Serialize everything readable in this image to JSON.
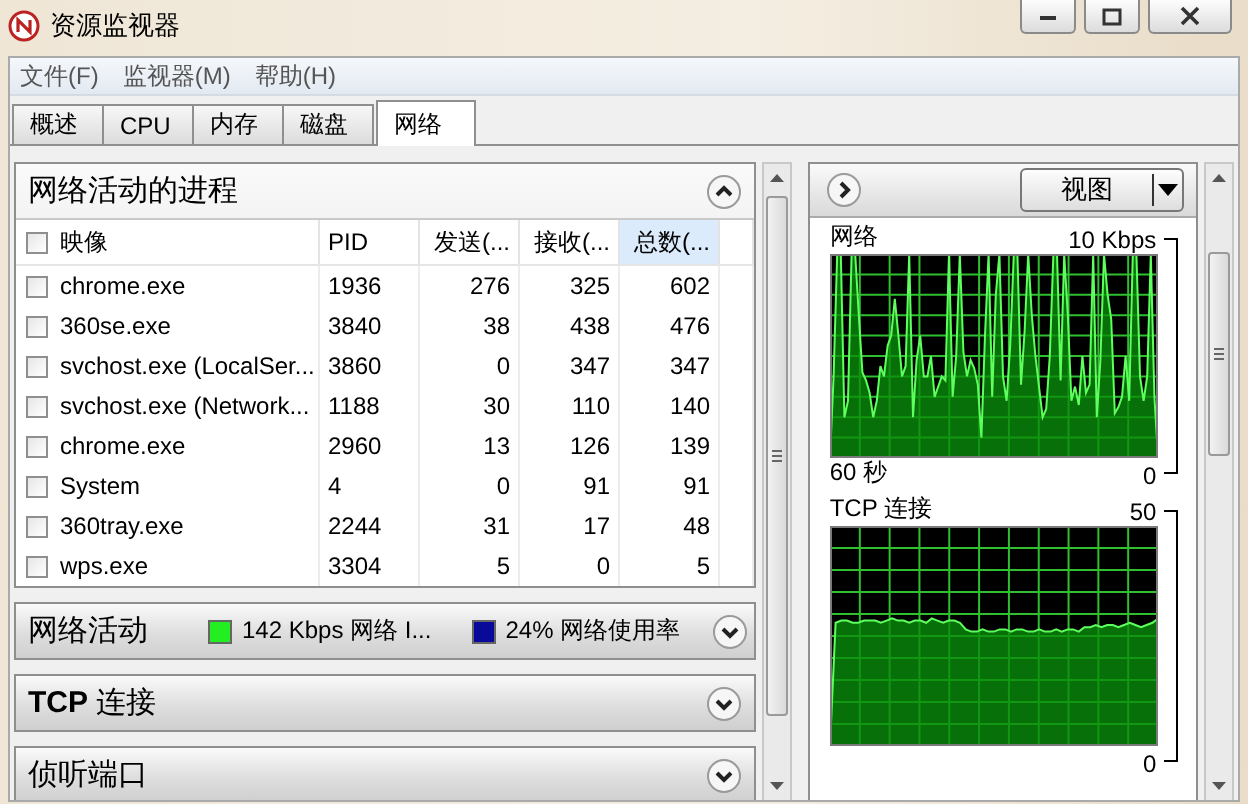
{
  "window": {
    "title": "资源监视器"
  },
  "menu": [
    "文件(F)",
    "监视器(M)",
    "帮助(H)"
  ],
  "tabs": [
    {
      "label": "概述",
      "selected": false
    },
    {
      "label": "CPU",
      "selected": false
    },
    {
      "label": "内存",
      "selected": false
    },
    {
      "label": "磁盘",
      "selected": false
    },
    {
      "label": "网络",
      "selected": true
    }
  ],
  "processes": {
    "title": "网络活动的进程",
    "expanded": true,
    "columns": [
      {
        "label": "映像",
        "sorted": false
      },
      {
        "label": "PID",
        "sorted": false
      },
      {
        "label": "发送(...",
        "sorted": false
      },
      {
        "label": "接收(...",
        "sorted": false
      },
      {
        "label": "总数(...",
        "sorted": true
      }
    ],
    "header_checked": false,
    "rows": [
      {
        "checked": false,
        "cells": [
          "chrome.exe",
          "1936",
          "276",
          "325",
          "602"
        ]
      },
      {
        "checked": false,
        "cells": [
          "360se.exe",
          "3840",
          "38",
          "438",
          "476"
        ]
      },
      {
        "checked": false,
        "cells": [
          "svchost.exe (LocalSer...",
          "3860",
          "0",
          "347",
          "347"
        ]
      },
      {
        "checked": false,
        "cells": [
          "svchost.exe (Network...",
          "1188",
          "30",
          "110",
          "140"
        ]
      },
      {
        "checked": false,
        "cells": [
          "chrome.exe",
          "2960",
          "13",
          "126",
          "139"
        ]
      },
      {
        "checked": false,
        "cells": [
          "System",
          "4",
          "0",
          "91",
          "91"
        ]
      },
      {
        "checked": false,
        "cells": [
          "360tray.exe",
          "2244",
          "31",
          "17",
          "48"
        ]
      },
      {
        "checked": false,
        "cells": [
          "wps.exe",
          "3304",
          "5",
          "0",
          "5"
        ]
      }
    ]
  },
  "sections": [
    {
      "title": "网络活动",
      "expanded": false,
      "legend": [
        {
          "text": "142 Kbps 网络 I...",
          "color": "#22ee22"
        },
        {
          "text": "24% 网络使用率",
          "color": "#0a0a9a"
        }
      ]
    },
    {
      "title": "**TCP** 连接",
      "expanded": false
    },
    {
      "title": "侦听端口",
      "expanded": false
    }
  ],
  "side": {
    "view_button": "视图",
    "graphs": [
      {
        "title": "网络",
        "max": "10 Kbps",
        "time": "60 秒",
        "min": "0",
        "kind": "spiky"
      },
      {
        "title": "TCP 连接",
        "max": "50",
        "min": "0",
        "kind": "flat"
      }
    ]
  }
}
